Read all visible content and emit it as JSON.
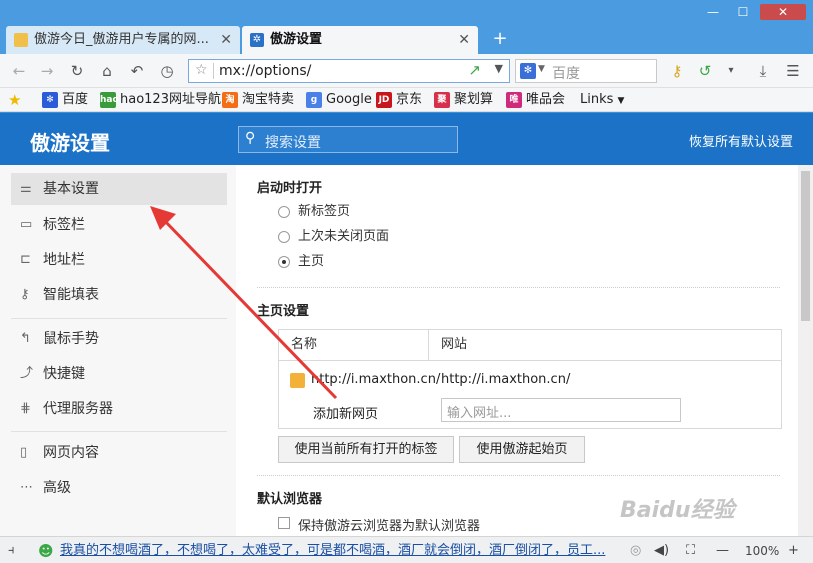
{
  "window": {
    "minimize_symbol": "—",
    "maximize_symbol": "☐",
    "close_symbol": "✕"
  },
  "tabs": [
    {
      "label": "傲游今日_傲游用户专属的网...",
      "active": false
    },
    {
      "label": "傲游设置",
      "active": true
    }
  ],
  "new_tab_symbol": "+",
  "address_bar": {
    "url": "mx://options/"
  },
  "search_box": {
    "placeholder": "百度",
    "engine_icon": "paw-icon"
  },
  "bookmarks": [
    {
      "label": "百度",
      "icon_color": "#2a5bd8",
      "icon_text": "🐾"
    },
    {
      "label": "hao123网址导航",
      "icon_color": "#3a9b3a",
      "icon_text": "hao"
    },
    {
      "label": "淘宝特卖",
      "icon_color": "#f26d16",
      "icon_text": "淘"
    },
    {
      "label": "Google",
      "icon_color": "#4a80e8",
      "icon_text": "g"
    },
    {
      "label": "京东",
      "icon_color": "#c8161d",
      "icon_text": "JD"
    },
    {
      "label": "聚划算",
      "icon_color": "#d6304a",
      "icon_text": "聚"
    },
    {
      "label": "唯品会",
      "icon_color": "#d02a7d",
      "icon_text": "唯"
    },
    {
      "label": "Links",
      "icon_color": "",
      "icon_text": ""
    }
  ],
  "header": {
    "title": "傲游设置",
    "search_placeholder": "搜索设置",
    "restore_label": "恢复所有默认设置"
  },
  "sidebar": {
    "items": [
      {
        "label": "基本设置",
        "icon": "sliders-icon",
        "active": true
      },
      {
        "label": "标签栏",
        "icon": "tab-icon",
        "active": false
      },
      {
        "label": "地址栏",
        "icon": "address-icon",
        "active": false
      },
      {
        "label": "智能填表",
        "icon": "key-icon",
        "active": false
      },
      {
        "label": "鼠标手势",
        "icon": "mouse-gesture-icon",
        "active": false
      },
      {
        "label": "快捷键",
        "icon": "shortcut-icon",
        "active": false
      },
      {
        "label": "代理服务器",
        "icon": "proxy-icon",
        "active": false
      },
      {
        "label": "网页内容",
        "icon": "page-icon",
        "active": false
      },
      {
        "label": "高级",
        "icon": "more-icon",
        "active": false
      }
    ]
  },
  "startup": {
    "title": "启动时打开",
    "options": [
      {
        "label": "新标签页",
        "selected": false
      },
      {
        "label": "上次未关闭页面",
        "selected": false
      },
      {
        "label": "主页",
        "selected": true
      }
    ]
  },
  "homepage": {
    "title": "主页设置",
    "col_name": "名称",
    "col_site": "网站",
    "rows": [
      {
        "name": "http://i.maxthon.cn/",
        "site": "http://i.maxthon.cn/"
      }
    ],
    "add_label": "添加新网页",
    "add_placeholder": "输入网址...",
    "btn_use_tabs": "使用当前所有打开的标签",
    "btn_use_start": "使用傲游起始页"
  },
  "default_browser": {
    "title": "默认浏览器",
    "checkbox_label": "保持傲游云浏览器为默认浏览器",
    "checked": false
  },
  "statusbar": {
    "news": "我真的不想喝酒了，不想喝了，太难受了，可是都不喝酒，酒厂就会倒闭，酒厂倒闭了，员工...",
    "zoom": "100%"
  },
  "watermark": "Baidu经验"
}
